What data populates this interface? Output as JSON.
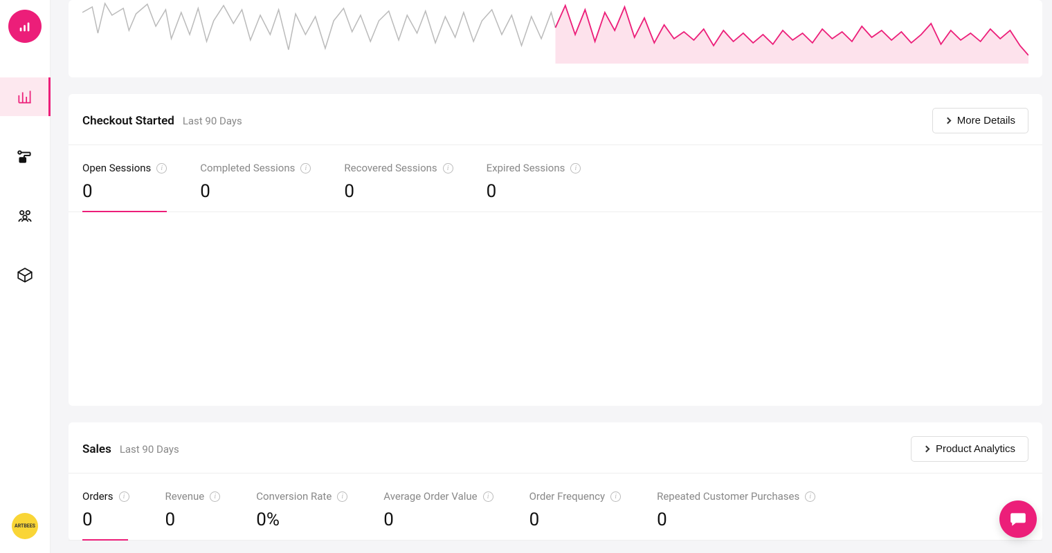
{
  "brand_color": "#ec1e79",
  "sidebar": {
    "items": [
      "analytics",
      "flows",
      "audience",
      "products"
    ],
    "active_index": 0,
    "avatar_label": "ARTBEES"
  },
  "top_chart": {
    "note": "partial area chart at top of viewport"
  },
  "checkout_card": {
    "title": "Checkout Started",
    "subtitle": "Last 90 Days",
    "action_label": "More Details",
    "tabs": [
      {
        "label": "Open Sessions",
        "value": "0",
        "active": true
      },
      {
        "label": "Completed Sessions",
        "value": "0",
        "active": false
      },
      {
        "label": "Recovered Sessions",
        "value": "0",
        "active": false
      },
      {
        "label": "Expired Sessions",
        "value": "0",
        "active": false
      }
    ]
  },
  "sales_card": {
    "title": "Sales",
    "subtitle": "Last 90 Days",
    "action_label": "Product Analytics",
    "tabs": [
      {
        "label": "Orders",
        "value": "0",
        "active": true
      },
      {
        "label": "Revenue",
        "value": "0",
        "active": false
      },
      {
        "label": "Conversion Rate",
        "value": "0%",
        "active": false
      },
      {
        "label": "Average Order Value",
        "value": "0",
        "active": false
      },
      {
        "label": "Order Frequency",
        "value": "0",
        "active": false
      },
      {
        "label": "Repeated Customer Purchases",
        "value": "0",
        "active": false
      }
    ]
  },
  "chart_data": {
    "type": "area",
    "series": [
      {
        "name": "previous-period",
        "color": "#bbbbbb",
        "fill": "none",
        "values_estimated": true
      },
      {
        "name": "current-period",
        "color": "#ec1e79",
        "fill": "#fde2ec",
        "values_estimated": true
      }
    ],
    "note": "Chart truncated at top of viewport; axes and exact values not visible"
  }
}
